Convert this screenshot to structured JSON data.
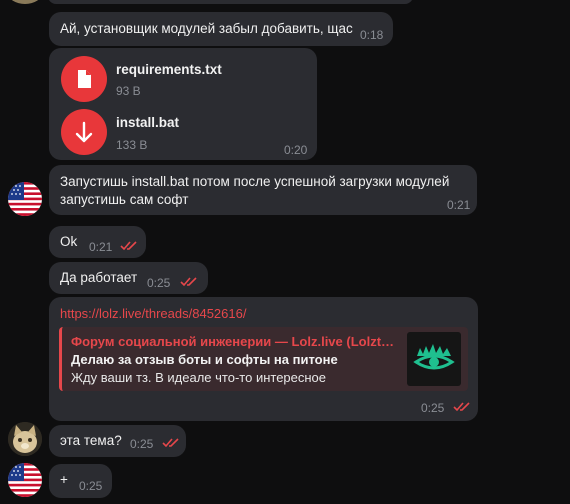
{
  "messages": {
    "m1": {
      "text": "Ай, установщик модулей забыл добавить, щас",
      "time": "0:18"
    },
    "files": {
      "f1": {
        "name": "requirements.txt",
        "size": "93 B",
        "icon": "file-icon"
      },
      "f2": {
        "name": "install.bat",
        "size": "133 B",
        "icon": "download-icon"
      },
      "time": "0:20"
    },
    "m2": {
      "line1": "Запустишь install.bat потом после успешной загрузки модулей",
      "line2": "запустишь сам софт",
      "time": "0:21"
    },
    "m3": {
      "text": "Ok",
      "time": "0:21"
    },
    "m4": {
      "text": "Да работает",
      "time": "0:25"
    },
    "m5": {
      "link": "https://lolz.live/threads/8452616/",
      "preview": {
        "site": "Форум социальной инженерии — Lolz.live (Lolzt…",
        "title": "Делаю за отзыв боты и софты на питоне",
        "desc": "Жду ваши тз. В идеале что-то интересное"
      },
      "time": "0:25"
    },
    "m6": {
      "text": "эта тема?",
      "time": "0:25"
    },
    "m7": {
      "text": "+",
      "time": "0:25"
    }
  },
  "colors": {
    "accent": "#e8373a",
    "bubble": "#2b2c31",
    "read_check": "#e6474b"
  }
}
